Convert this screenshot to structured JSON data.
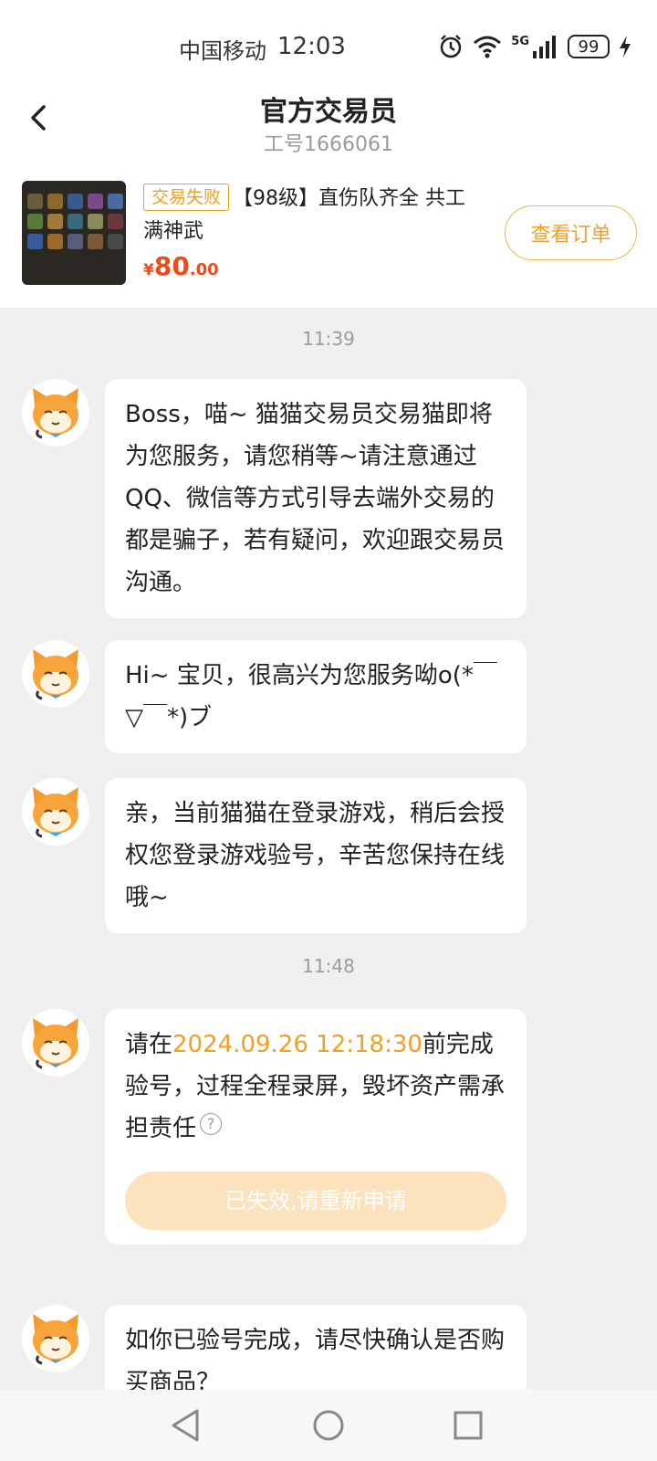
{
  "status_bar": {
    "carrier": "中国移动",
    "time": "12:03",
    "network": "5G",
    "battery": "99"
  },
  "header": {
    "title": "官方交易员",
    "subtitle": "工号1666061"
  },
  "order": {
    "status_tag": "交易失败",
    "description": "【98级】直伤队齐全 共工满神武",
    "currency": "¥",
    "price_int": "80",
    "price_dec": ".00",
    "view_button": "查看订单"
  },
  "chat": {
    "timestamps": [
      "11:39",
      "11:48"
    ],
    "messages": [
      {
        "text": "Boss，喵~ 猫猫交易员交易猫即将为您服务，请您稍等~请注意通过QQ、微信等方式引导去端外交易的都是骗子，若有疑问，欢迎跟交易员沟通。"
      },
      {
        "text": "Hi~ 宝贝，很高兴为您服务呦o(*￣▽￣*)ブ"
      },
      {
        "text": "亲，当前猫猫在登录游戏，稍后会授权您登录游戏验号，辛苦您保持在线哦~"
      },
      {
        "text_before": "请在",
        "deadline": "2024.09.26 12:18:30",
        "text_after": "前完成验号，过程全程录屏，毁坏资产需承担责任",
        "help_icon": "?",
        "button": "已失效,请重新申请"
      },
      {
        "text": "如你已验号完成，请尽快确认是否购买商品？"
      }
    ]
  },
  "colors": {
    "accent": "#f0a024",
    "price": "#f04a1a",
    "disabled_button": "#fde3bd",
    "chat_bg": "#efefef"
  },
  "icons": [
    "back-arrow-icon",
    "alarm-icon",
    "wifi-icon",
    "signal-icon",
    "charging-icon",
    "cat-avatar-icon",
    "help-icon",
    "nav-back-icon",
    "nav-home-icon",
    "nav-recents-icon"
  ]
}
